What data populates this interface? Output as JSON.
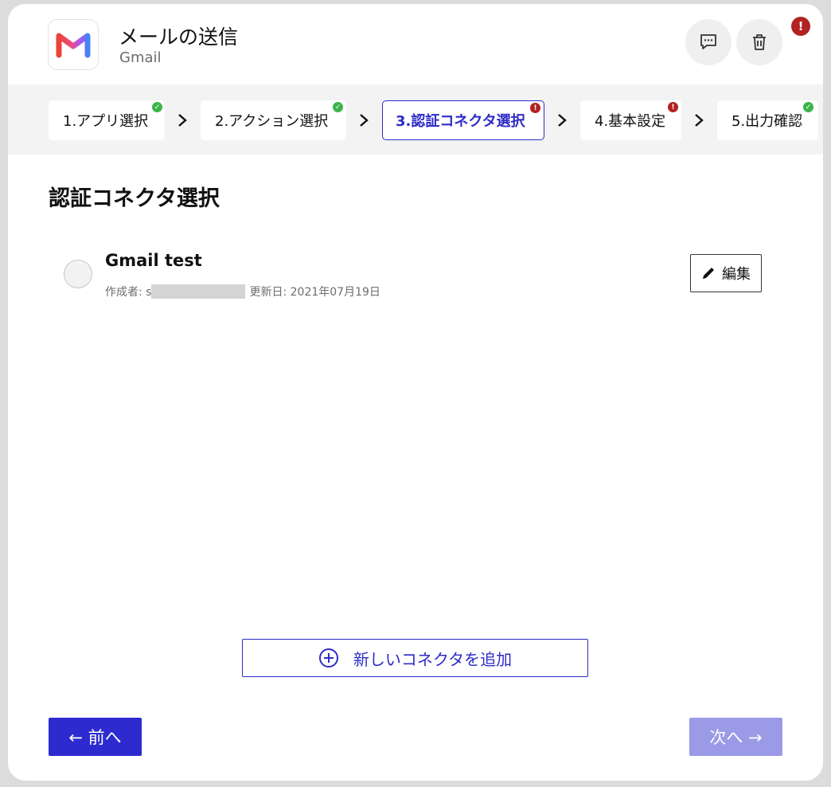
{
  "header": {
    "title": "メールの送信",
    "subtitle": "Gmail",
    "alert_badge": "!"
  },
  "steps": [
    {
      "label": "1.アプリ選択",
      "status": "ok"
    },
    {
      "label": "2.アクション選択",
      "status": "ok"
    },
    {
      "label": "3.認証コネクタ選択",
      "status": "error",
      "active": true
    },
    {
      "label": "4.基本設定",
      "status": "error"
    },
    {
      "label": "5.出力確認",
      "status": "ok"
    }
  ],
  "section": {
    "title": "認証コネクタ選択"
  },
  "connector": {
    "name": "Gmail test",
    "author_label": "作成者: s",
    "updated": "更新日: 2021年07月19日",
    "edit_label": "編集"
  },
  "add_connector_label": "新しいコネクタを追加",
  "footer": {
    "prev_label": "← 前へ",
    "next_label": "次へ →"
  },
  "colors": {
    "accent": "#2d2bc7",
    "ok": "#3bb54a",
    "error": "#b22222",
    "disabled": "#9b9ae6"
  }
}
